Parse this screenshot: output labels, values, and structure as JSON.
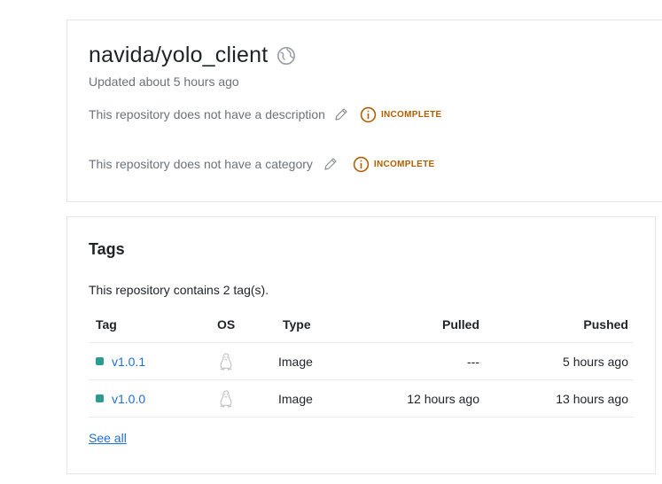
{
  "repo": {
    "name": "navida/yolo_client",
    "visibility_icon": "globe-icon",
    "updated": "Updated about 5 hours ago",
    "description_text": "This repository does not have a description",
    "category_text": "This repository does not have a category",
    "incomplete_label": "INCOMPLETE",
    "colors": {
      "warning": "#b25d00",
      "link": "#1f6fd1",
      "tag_dot": "#2b9c8f"
    }
  },
  "tags": {
    "title": "Tags",
    "count_text": "This repository contains 2 tag(s).",
    "columns": {
      "tag": "Tag",
      "os": "OS",
      "type": "Type",
      "pulled": "Pulled",
      "pushed": "Pushed"
    },
    "rows": [
      {
        "tag": "v1.0.1",
        "os_icon": "linux-icon",
        "type": "Image",
        "pulled": "---",
        "pushed": "5 hours ago"
      },
      {
        "tag": "v1.0.0",
        "os_icon": "linux-icon",
        "type": "Image",
        "pulled": "12 hours ago",
        "pushed": "13 hours ago"
      }
    ],
    "see_all": "See all"
  }
}
